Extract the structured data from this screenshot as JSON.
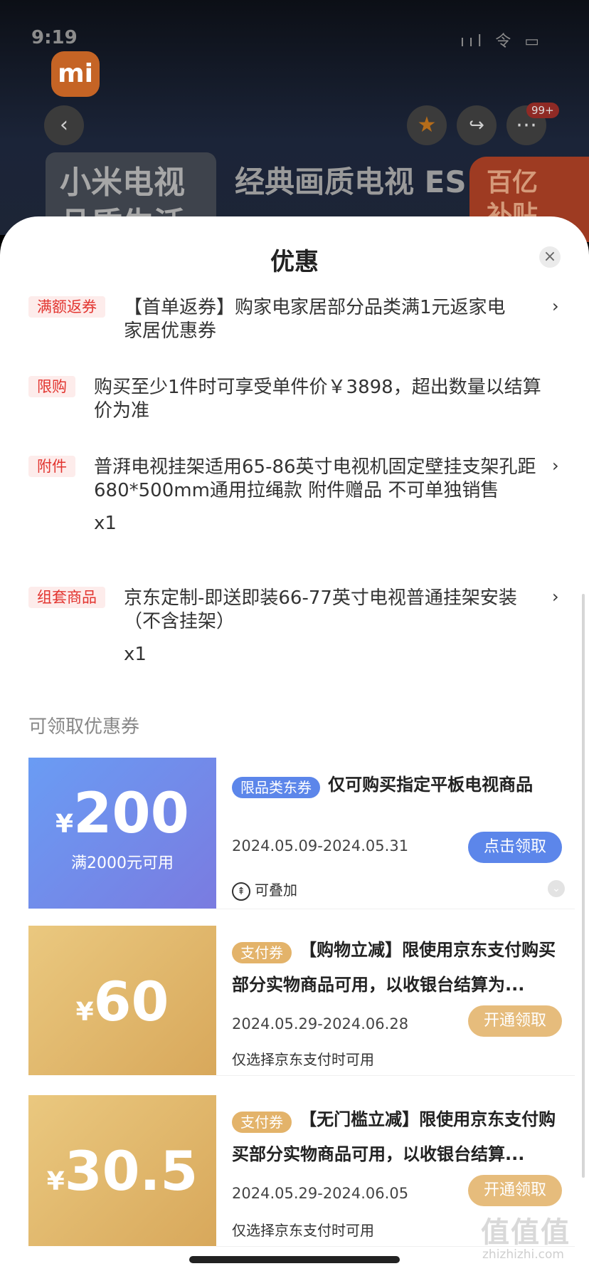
{
  "status_bar": {
    "time": "9:19",
    "icons": "ııl 令 ▭"
  },
  "header": {
    "logo": "mi",
    "back_icon": "‹",
    "favorite_icon": "★",
    "share_icon": "↪",
    "more_icon": "⋯",
    "notification_badge": "99+",
    "banner_left": "小米电视 品质生活",
    "banner_title": "经典画质电视 ES",
    "banner_badge": "百亿 补贴"
  },
  "sheet": {
    "title": "优惠",
    "close_icon": "×",
    "promotions": [
      {
        "tag": "满额返券",
        "text": "【首单返券】购家电家居部分品类满1元返家电家居优惠券",
        "qty": "",
        "arrow": "›"
      },
      {
        "tag": "限购",
        "text": "购买至少1件时可享受单件价￥3898，超出数量以结算价为准",
        "qty": "",
        "arrow": ""
      },
      {
        "tag": "附件",
        "text": "普湃电视挂架适用65-86英寸电视机固定壁挂支架孔距680*500mm通用拉绳款 附件赠品 不可单独销售",
        "qty": "x1",
        "arrow": "›"
      },
      {
        "tag": "组套商品",
        "text": "京东定制-即送即装66-77英寸电视普通挂架安装（不含挂架）",
        "qty": "x1",
        "arrow": "›"
      }
    ],
    "coupon_section_title": "可领取优惠券",
    "coupons": [
      {
        "currency": "¥",
        "amount": "200",
        "condition": "满2000元可用",
        "tag": "限品类东券",
        "title": "仅可购买指定平板电视商品",
        "date": "2024.05.09-2024.05.31",
        "button": "点击领取",
        "note": "可叠加",
        "note_icon": "⇞"
      },
      {
        "currency": "¥",
        "amount": "60",
        "condition": "",
        "tag": "支付券",
        "title": "【购物立减】限使用京东支付购买部分实物商品可用，以收银台结算为...",
        "date": "2024.05.29-2024.06.28",
        "button": "开通领取",
        "note": "仅选择京东支付时可用"
      },
      {
        "currency": "¥",
        "amount": "30.5",
        "condition": "",
        "tag": "支付券",
        "title": "【无门槛立减】限使用京东支付购买部分实物商品可用，以收银台结算...",
        "date": "2024.05.29-2024.06.05",
        "button": "开通领取",
        "note": "仅选择京东支付时可用"
      }
    ]
  },
  "watermark": {
    "text": "值值值",
    "url": "zhizhizhi.com"
  }
}
